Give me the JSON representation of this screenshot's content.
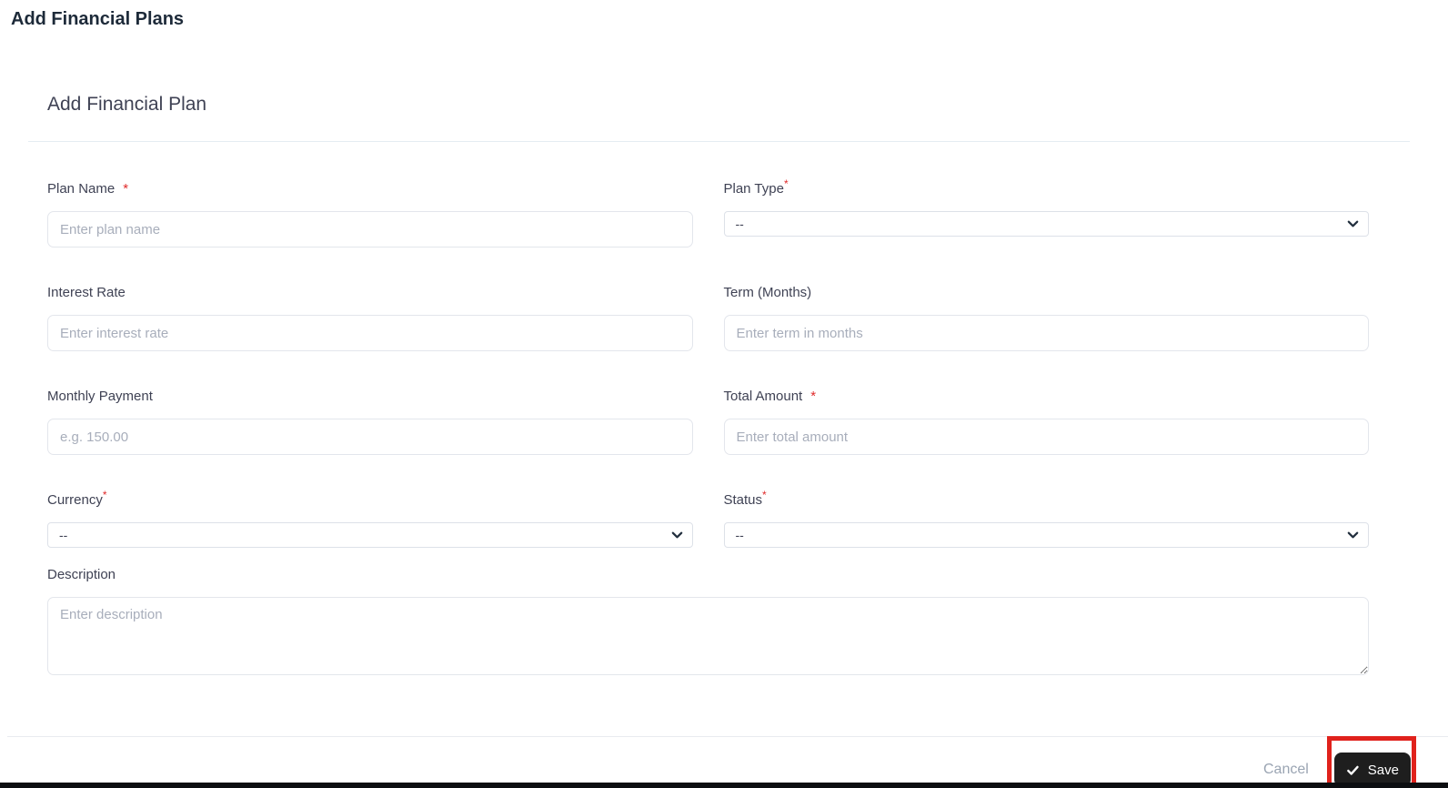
{
  "page": {
    "title": "Add Financial Plans"
  },
  "card": {
    "heading": "Add Financial Plan"
  },
  "form": {
    "required_marker": "*",
    "fields": [
      {
        "id": "plan_name",
        "label": "Plan Name",
        "type": "text",
        "placeholder": "Enter plan name",
        "required": true,
        "marker_style": "inline"
      },
      {
        "id": "plan_type",
        "label": "Plan Type",
        "type": "select",
        "value": "--",
        "required": true,
        "marker_style": "sup"
      },
      {
        "id": "interest_rate",
        "label": "Interest Rate",
        "type": "text",
        "placeholder": "Enter interest rate",
        "required": false
      },
      {
        "id": "term_months",
        "label": "Term (Months)",
        "type": "text",
        "placeholder": "Enter term in months",
        "required": false
      },
      {
        "id": "monthly_payment",
        "label": "Monthly Payment",
        "type": "text",
        "placeholder": "e.g. 150.00",
        "required": false
      },
      {
        "id": "total_amount",
        "label": "Total Amount",
        "type": "text",
        "placeholder": "Enter total amount",
        "required": true,
        "marker_style": "inline"
      },
      {
        "id": "currency",
        "label": "Currency",
        "type": "select",
        "value": "--",
        "required": true,
        "marker_style": "sup"
      },
      {
        "id": "status",
        "label": "Status",
        "type": "select",
        "value": "--",
        "required": true,
        "marker_style": "sup"
      },
      {
        "id": "description",
        "label": "Description",
        "type": "textarea",
        "placeholder": "Enter description",
        "required": false
      }
    ]
  },
  "footer": {
    "cancel_label": "Cancel",
    "save_label": "Save",
    "save_icon": "check-icon"
  },
  "colors": {
    "label_text": "#3f4254",
    "page_title_text": "#1d2a39",
    "placeholder_text": "#a8aebb",
    "input_border": "#e3e6ec",
    "select_border": "#dde1e8",
    "divider": "#e5ecf2",
    "cancel_text": "#9aa4b2",
    "save_background": "#1e1e1e",
    "save_text": "#ffffff",
    "required_marker": "#e02b2b",
    "highlight_red": "#e0221c",
    "bottom_bar": "#0c0e11"
  }
}
